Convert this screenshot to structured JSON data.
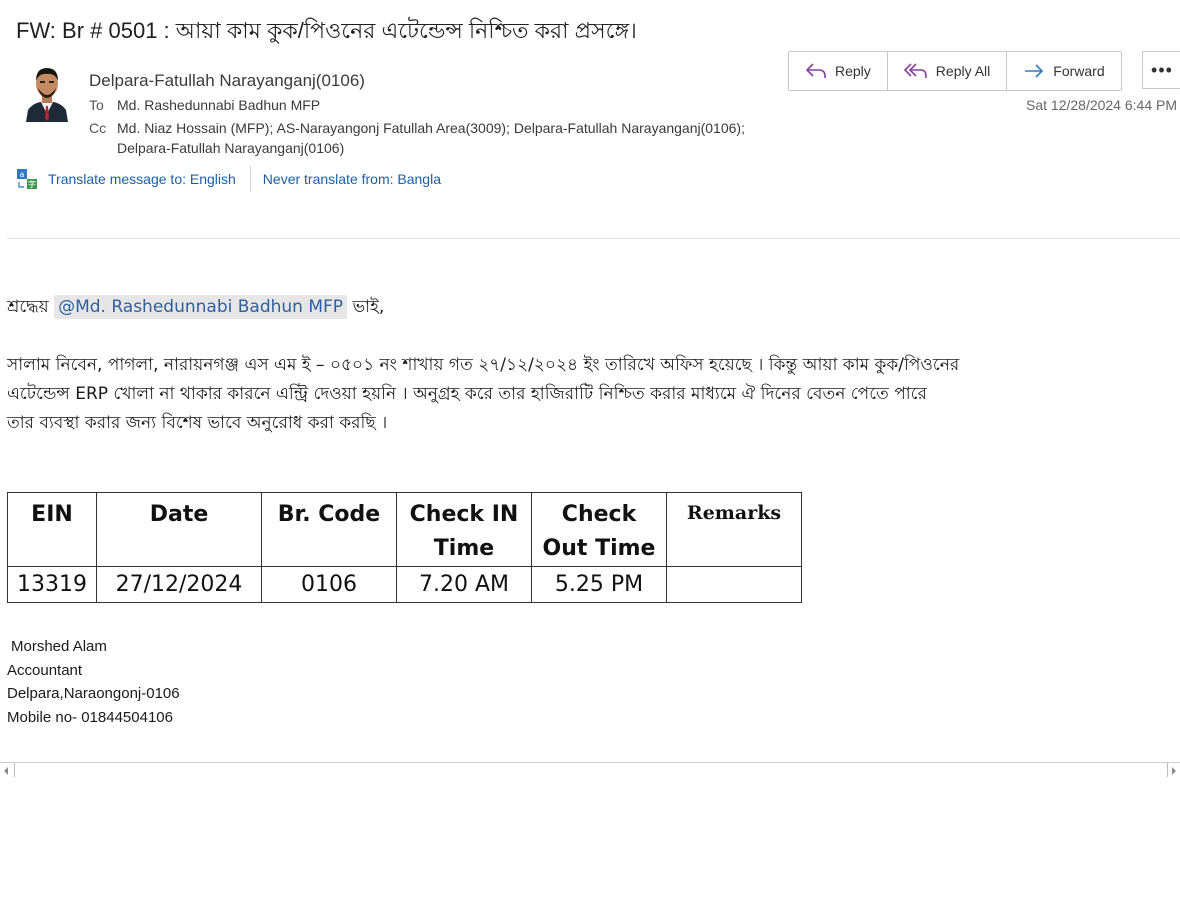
{
  "subject": "FW:  Br  #  0501  : আয়া কাম কুক/পিওনের এটেন্ডেন্স নিশ্চিত করা প্রসঙ্গে।",
  "sender": "Delpara-Fatullah Narayanganj(0106)",
  "to_label": "To",
  "to_value": "Md. Rashedunnabi Badhun MFP",
  "cc_label": "Cc",
  "cc_line1": "Md. Niaz Hossain (MFP); AS-Narayangonj Fatullah Area(3009); Delpara-Fatullah Narayanganj(0106);",
  "cc_line2": "Delpara-Fatullah Narayanganj(0106)",
  "actions": {
    "reply": "Reply",
    "reply_all": "Reply All",
    "forward": "Forward",
    "more": "•••"
  },
  "sent_date": "Sat 12/28/2024 6:44 PM",
  "translate": {
    "translate_to": "Translate message to: English",
    "never_translate": "Never translate from: Bangla"
  },
  "greeting": {
    "prefix": "শ্রদ্ধেয়",
    "mention": "@Md.  Rashedunnabi  Badhun  MFP",
    "suffix": "ভাই,"
  },
  "body_lines": [
    "সালাম নিবেন, পাগলা, নারায়নগঞ্জ এস এম ই – ০৫০১ নং শাখায় গত ২৭/১২/২০২৪ ইং তারিখে অফিস হয়েছে । কিন্তু আয়া কাম কুক/পিওনের",
    "এটেন্ডেন্স ERP খোলা না থাকার কারনে এন্ট্রি  দেওয়া হয়নি । অনুগ্রহ করে তার হাজিরাটি নিশ্চিত করার মাধ্যমে ঐ দিনের বেতন পেতে পারে",
    "তার ব্যবস্থা করার জন্য বিশেষ ভাবে অনুরোধ করা করছি ।"
  ],
  "table": {
    "headers": [
      "EIN",
      "Date",
      "Br. Code",
      "Check IN Time",
      "Check Out Time",
      "Remarks"
    ],
    "row": [
      "13319",
      "27/12/2024",
      "0106",
      "7.20  AM",
      "5.25  PM",
      ""
    ]
  },
  "signature": {
    "name": "Morshed Alam",
    "title": "Accountant",
    "branch": "Delpara,Naraongonj-0106",
    "mobile": "Mobile no- 01844504106"
  }
}
